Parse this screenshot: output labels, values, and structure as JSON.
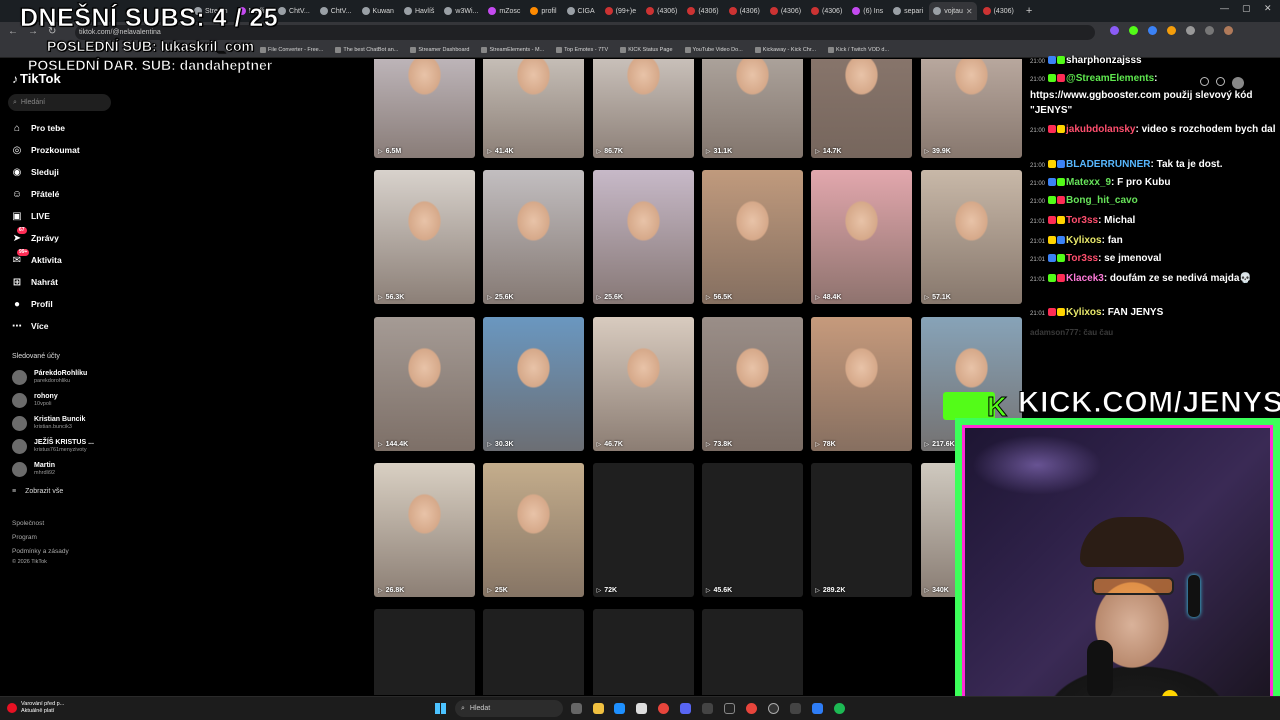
{
  "overlay": {
    "subs_label": "DNEŠNÍ SUBS: 4 / 25",
    "last_sub": "POSLEDNÍ SUB: lukaskril_com",
    "last_gift_sub": "POSLEDNÍ DAR. SUB: dandaheptner"
  },
  "browser": {
    "tabs": [
      "Stream",
      "Netflix",
      "ChtV...",
      "ChtV...",
      "Kuwan",
      "Havlíš",
      "w3Wi...",
      "mZosc",
      "profil",
      "CIGA",
      "(99+)e",
      "(4306)",
      "(4306)",
      "(4306)",
      "(4306)",
      "(4306)",
      "(6) Ins",
      "separi",
      "vojtau"
    ],
    "active_tab": "",
    "tab_after_active": "(4306)",
    "url": "tiktok.com/@nelavalentina",
    "bookmarks": [
      "File Converter - Free...",
      "The best ChatBot an...",
      "Streamer Dashboard",
      "StreamElements - M...",
      "Top Emotes - 7TV",
      "KICK Status Page",
      "YouTube Video Do...",
      "Kickaway - Kick Chr...",
      "Kick / Twitch VOD d..."
    ]
  },
  "tiktok": {
    "logo": "TikTok",
    "search_placeholder": "Hledání",
    "nav": [
      {
        "label": "Pro tebe",
        "icon": "home-icon"
      },
      {
        "label": "Prozkoumat",
        "icon": "compass-icon"
      },
      {
        "label": "Sleduji",
        "icon": "following-icon"
      },
      {
        "label": "Přátelé",
        "icon": "friends-icon"
      },
      {
        "label": "LIVE",
        "icon": "live-icon"
      },
      {
        "label": "Zprávy",
        "icon": "send-icon",
        "badge": "67"
      },
      {
        "label": "Aktivita",
        "icon": "inbox-icon",
        "badge": "99+"
      },
      {
        "label": "Nahrát",
        "icon": "upload-icon"
      },
      {
        "label": "Profil",
        "icon": "profile-icon"
      },
      {
        "label": "Více",
        "icon": "more-icon"
      }
    ],
    "following_title": "Sledované účty",
    "accounts": [
      {
        "name": "PárekdoRohlíku",
        "handle": "parekdorohliku"
      },
      {
        "name": "rohony",
        "handle": "10vpoli"
      },
      {
        "name": "Kristian Buncik",
        "handle": "kristian.buncik3"
      },
      {
        "name": "JEŽÍŠ KRISTUS ...",
        "handle": "kristus761menyzivoty"
      },
      {
        "name": "Martin",
        "handle": "mhrdli92"
      }
    ],
    "show_all": "Zobrazit vše",
    "footer": [
      "Společnost",
      "Program",
      "Podmínky a zásady",
      "© 2026 TikTok"
    ],
    "videos": [
      {
        "views": "6.5M",
        "color": "#cfc8cf"
      },
      {
        "views": "41.4K",
        "color": "#d9d3cc"
      },
      {
        "views": "86.7K",
        "color": "#ddd6d0"
      },
      {
        "views": "31.1K",
        "color": "#b9b1aa"
      },
      {
        "views": "14.7K",
        "color": "#8d7a70"
      },
      {
        "views": "39.9K",
        "color": "#c9b8ae"
      },
      {
        "views": "56.3K",
        "color": "#d8d2cc"
      },
      {
        "views": "25.6K",
        "color": "#c2bec0"
      },
      {
        "views": "25.6K",
        "color": "#c7b9c8"
      },
      {
        "views": "56.5K",
        "color": "#c09a7d"
      },
      {
        "views": "48.4K",
        "color": "#e2a7ad"
      },
      {
        "views": "57.1K",
        "color": "#c8b8a8"
      },
      {
        "views": "144.4K",
        "color": "#a59b95"
      },
      {
        "views": "30.3K",
        "color": "#6a97c0"
      },
      {
        "views": "46.7K",
        "color": "#d8cbbf"
      },
      {
        "views": "73.8K",
        "color": "#9a8e88"
      },
      {
        "views": "78K",
        "color": "#c69a7c"
      },
      {
        "views": "217.6K",
        "color": "#87a3b8"
      },
      {
        "views": "26.8K",
        "color": "#d9d0c3"
      },
      {
        "views": "25K",
        "color": "#c4ad8c"
      },
      {
        "views": "72K",
        "color": "#1f1f1f"
      },
      {
        "views": "45.6K",
        "color": "#1f1f1f"
      },
      {
        "views": "289.2K",
        "color": "#1f1f1f"
      },
      {
        "views": "340K",
        "color": "#cfc9bf"
      },
      {
        "views": "",
        "color": "#1f1f1f"
      },
      {
        "views": "",
        "color": "#1f1f1f"
      },
      {
        "views": "",
        "color": "#1f1f1f"
      },
      {
        "views": "",
        "color": "#1f1f1f"
      }
    ]
  },
  "chat": {
    "messages": [
      {
        "time": "21:00",
        "user": "sharphonzajsss",
        "text": "",
        "color": "#ffffff"
      },
      {
        "time": "21:00",
        "user": "@StreamElements",
        "text": ": https://www.ggbooster.com použij slevový kód \"JENYS\"",
        "color": "#5fe84f"
      },
      {
        "time": "21:00",
        "user": "jakubdolansky",
        "text": ": video s rozchodem bych dal",
        "color": "#ff4f6e"
      },
      {
        "time": "21:00",
        "user": "BLADERRUNNER",
        "text": ": Tak ta je dost.",
        "color": "#58b8ff"
      },
      {
        "time": "21:00",
        "user": "Matexx_9",
        "text": ": F pro Kubu",
        "color": "#67e35a"
      },
      {
        "time": "21:00",
        "user": "Bong_hit_cavo",
        "text": "",
        "color": "#67e35a"
      },
      {
        "time": "21:01",
        "user": "Tor3ss",
        "text": ": Michal",
        "color": "#ff4f6e"
      },
      {
        "time": "21:01",
        "user": "Kylixos",
        "text": ": fan",
        "color": "#e8e86a"
      },
      {
        "time": "21:01",
        "user": "Tor3ss",
        "text": ": se jmenoval",
        "color": "#ff4f6e"
      },
      {
        "time": "21:01",
        "user": "Klacek3",
        "text": ": doufám ze se nedivá majda💀",
        "color": "#ff7ad9"
      },
      {
        "time": "21:01",
        "user": "Kylixos",
        "text": ": FAN JENYS",
        "color": "#e8e86a"
      }
    ],
    "ghost_message": {
      "user": "adamson777",
      "text": ": čau čau"
    }
  },
  "webcam": {
    "banner": "KICK.COM/JENYSS"
  },
  "taskbar": {
    "notif_title": "Varování před p...",
    "notif_sub": "Aktuálně platí",
    "search_placeholder": "Hledat"
  },
  "colors": {
    "accent_tiktok": "#fe2c55",
    "kick_green": "#53fc18",
    "frame_green": "#3cff5a",
    "frame_pink": "#ff2bd6"
  }
}
